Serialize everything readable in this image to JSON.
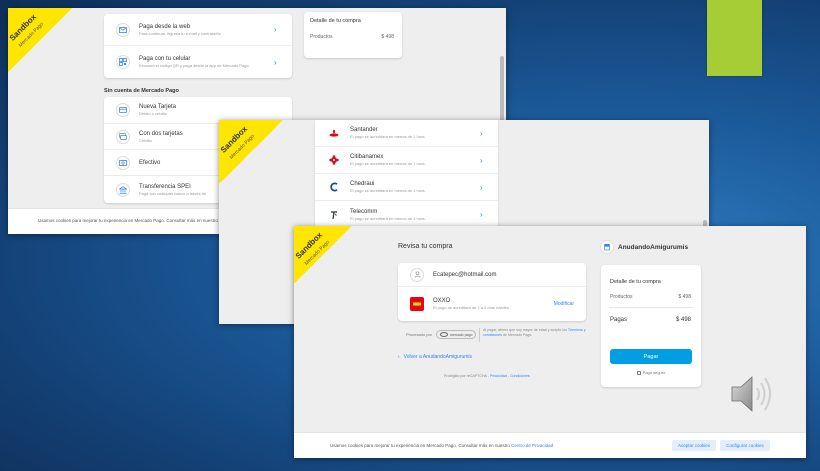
{
  "sandbox": {
    "label": "Sandbox",
    "sublabel": "Mercado Pago"
  },
  "window1": {
    "rows_top": [
      {
        "title": "Paga desde la web",
        "subtitle": "Para continuar, ingresa tu e-mail y contraseña"
      },
      {
        "title": "Paga con tu celular",
        "subtitle": "Escanea el código QR y paga desde la app de Mercado Pago."
      }
    ],
    "section_title": "Sin cuenta de Mercado Pago",
    "rows_bottom": [
      {
        "title": "Nueva Tarjeta",
        "subtitle": "Débito o crédito"
      },
      {
        "title": "Con dos tarjetas",
        "subtitle": "Crédito"
      },
      {
        "title": "Efectivo",
        "subtitle": ""
      },
      {
        "title": "Transferencia SPEI",
        "subtitle": "Paga con cualquier banco a través de"
      }
    ],
    "summary": {
      "title": "Detalle de tu compra",
      "label": "Productos",
      "amount": "$ 498"
    },
    "cookie_text": "Usamos cookies para mejorar tu experiencia en Mercado Pago. Consultar más en nuestro"
  },
  "window2": {
    "rows": [
      {
        "title": "Santander",
        "subtitle": "El pago se acreditará en menos de 1 hora."
      },
      {
        "title": "Citibanamex",
        "subtitle": "El pago se acreditará en menos de 1 hora."
      },
      {
        "title": "Chedraui",
        "subtitle": "El pago se acreditará en menos de 1 hora."
      },
      {
        "title": "Telecomm",
        "subtitle": "El pago se acreditará en menos de 1 hora."
      }
    ]
  },
  "window3": {
    "page_title": "Revisa tu compra",
    "seller": "AnudandoAmigurumis",
    "email": "Ecatepec@hotmail.com",
    "payment": {
      "method": "OXXO",
      "note": "El pago se acreditará de 1 a 2 días hábiles.",
      "action": "Modificar"
    },
    "processed_by": "Procesado por",
    "mp_logo": "mercado pago",
    "legal_text": "Al pagar, afirmo que soy mayor de edad y acepto los",
    "legal_link": "Términos y condiciones",
    "legal_tail": "de Mercado Pago.",
    "back_link": "Volver a AnudandoAmigurumis",
    "recaptcha": "Protegido por reCAPTCHA -",
    "privacy": "Privacidad",
    "sep": "-",
    "conditions": "Condiciones",
    "summary": {
      "title": "Detalle de tu compra",
      "products_label": "Productos",
      "products_amount": "$ 498",
      "pay_label": "Pagas",
      "pay_amount": "$ 498",
      "button": "Pagar",
      "secure": "Pago seguro"
    },
    "cookie": {
      "text": "Usamos cookies para mejorar tu experiencia en Mercado Pago. Consultar más en nuestro",
      "link": "Centro de Privacidad",
      "accept": "Aceptar cookies",
      "configure": "Configurar cookies"
    }
  },
  "colors": {
    "accent": "#009ee3",
    "link": "#3483fa",
    "sandbox": "#ffe600",
    "slide_green": "#a6cd35"
  },
  "icons": [
    "mail-icon",
    "qr-icon",
    "card-icon",
    "two-cards-icon",
    "cash-icon",
    "bank-icon",
    "chevron-right-icon",
    "santander-icon",
    "citibanamex-icon",
    "chedraui-icon",
    "telecomm-icon",
    "store-icon",
    "oxxo-icon",
    "lock-icon",
    "speaker-icon",
    "back-chevron-icon"
  ]
}
